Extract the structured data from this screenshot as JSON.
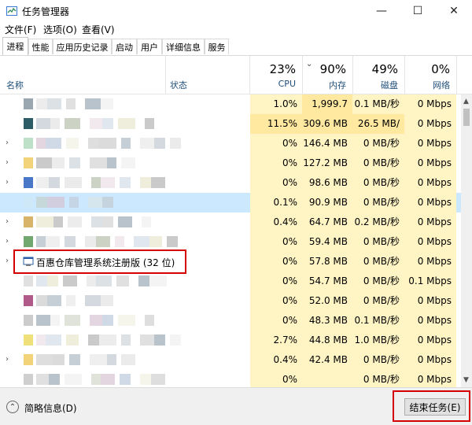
{
  "window": {
    "title": "任务管理器",
    "minimize_glyph": "—",
    "maximize_glyph": "☐",
    "close_glyph": "✕"
  },
  "menu": [
    "文件(F)",
    "选项(O)",
    "查看(V)"
  ],
  "tabs": [
    "进程",
    "性能",
    "应用历史记录",
    "启动",
    "用户",
    "详细信息",
    "服务"
  ],
  "header": {
    "name": "名称",
    "status": "状态",
    "cpu_pct": "23%",
    "cpu_label": "CPU",
    "mem_pct": "90%",
    "mem_label": "内存",
    "disk_pct": "49%",
    "disk_label": "磁盘",
    "net_pct": "0%",
    "net_label": "网络",
    "sort_glyph": "⌄"
  },
  "rows": [
    {
      "name": "",
      "cpu": "1.0%",
      "mem": "1,999.7 ...",
      "disk": "0.1 MB/秒",
      "net": "0 Mbps",
      "expand": false
    },
    {
      "name": "",
      "cpu": "11.5%",
      "mem": "309.6 MB",
      "disk": "26.5 MB/秒",
      "net": "0 Mbps",
      "expand": false
    },
    {
      "name": "",
      "cpu": "0%",
      "mem": "146.4 MB",
      "disk": "0 MB/秒",
      "net": "0 Mbps",
      "expand": true
    },
    {
      "name": "",
      "cpu": "0%",
      "mem": "127.2 MB",
      "disk": "0 MB/秒",
      "net": "0 Mbps",
      "expand": true
    },
    {
      "name": "",
      "cpu": "0%",
      "mem": "98.6 MB",
      "disk": "0 MB/秒",
      "net": "0 Mbps",
      "expand": true
    },
    {
      "name": "",
      "cpu": "0.1%",
      "mem": "90.9 MB",
      "disk": "0 MB/秒",
      "net": "0 Mbps",
      "expand": false
    },
    {
      "name": "",
      "cpu": "0.4%",
      "mem": "64.7 MB",
      "disk": "0.2 MB/秒",
      "net": "0 Mbps",
      "expand": true
    },
    {
      "name": "",
      "cpu": "0%",
      "mem": "59.4 MB",
      "disk": "0 MB/秒",
      "net": "0 Mbps",
      "expand": true
    },
    {
      "name": "百惠仓库管理系统注册版 (32 位)",
      "cpu": "0%",
      "mem": "57.8 MB",
      "disk": "0 MB/秒",
      "net": "0 Mbps",
      "expand": true
    },
    {
      "name": "",
      "cpu": "0%",
      "mem": "54.7 MB",
      "disk": "0 MB/秒",
      "net": "0.1 Mbps",
      "expand": false
    },
    {
      "name": "",
      "cpu": "0%",
      "mem": "52.0 MB",
      "disk": "0 MB/秒",
      "net": "0 Mbps",
      "expand": false
    },
    {
      "name": "",
      "cpu": "0%",
      "mem": "48.3 MB",
      "disk": "0.1 MB/秒",
      "net": "0 Mbps",
      "expand": false
    },
    {
      "name": "",
      "cpu": "2.7%",
      "mem": "44.8 MB",
      "disk": "1.0 MB/秒",
      "net": "0 Mbps",
      "expand": false
    },
    {
      "name": "",
      "cpu": "0.4%",
      "mem": "42.4 MB",
      "disk": "0 MB/秒",
      "net": "0 Mbps",
      "expand": true
    },
    {
      "name": "",
      "cpu": "0%",
      "mem": "",
      "disk": "0 MB/秒",
      "net": "0 Mbps",
      "expand": false
    }
  ],
  "footer": {
    "fewer_details": "简略信息(D)",
    "end_task": "结束任务(E)"
  },
  "colors": {
    "highlight_row": "#cce8ff",
    "cell_light": "#fff4c4",
    "cell_medium": "#ffe8a0",
    "annotation_red": "#d40000"
  }
}
